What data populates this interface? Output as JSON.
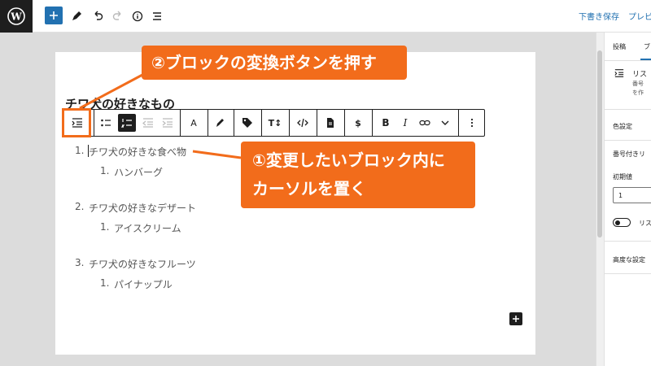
{
  "topbar": {
    "draft_label": "下書き保存",
    "preview_label": "プレビ"
  },
  "document": {
    "heading": "チワ犬の好きなもの",
    "list": [
      {
        "num": "1.",
        "text": "チワ犬の好きな食べ物",
        "sub": {
          "num": "1.",
          "text": "ハンバーグ"
        }
      },
      {
        "num": "2.",
        "text": "チワ犬の好きなデザート",
        "sub": {
          "num": "1.",
          "text": "アイスクリーム"
        }
      },
      {
        "num": "3.",
        "text": "チワ犬の好きなフルーツ",
        "sub": {
          "num": "1.",
          "text": "パイナップル"
        }
      }
    ]
  },
  "toolbar": {
    "text_color": "A",
    "typography": "T↕",
    "currency": "$",
    "bold": "B",
    "italic": "I"
  },
  "callouts": {
    "step2": "②ブロックの変換ボタンを押す",
    "step1_line1": "①変更したいブロック内に",
    "step1_line2": "カーソルを置く"
  },
  "sidebar": {
    "tab_post": "投稿",
    "tab_block": "ブ",
    "block_title": "リス",
    "block_desc1": "番号",
    "block_desc2": "を作",
    "color_settings": "色設定",
    "numbered_list": "番号付きリ",
    "start_value_label": "初期値",
    "start_value": "1",
    "reverse_label": "リス",
    "advanced": "高度な設定"
  },
  "colors": {
    "accent": "#f26c1b",
    "wp_blue": "#2271b1",
    "dark": "#1e1e1e"
  }
}
